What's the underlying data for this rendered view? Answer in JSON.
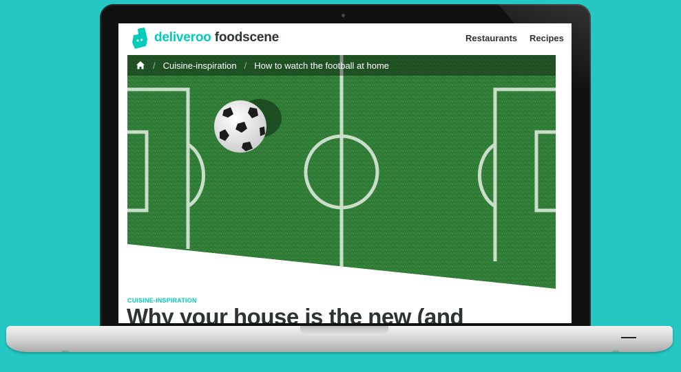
{
  "brand": {
    "name_part1": "deliveroo",
    "name_part2": "foodscene",
    "accent_color": "#00ccbc",
    "logo_icon": "deliveroo-kangaroo-logo"
  },
  "nav": {
    "links": [
      {
        "label": "Restaurants"
      },
      {
        "label": "Recipes"
      }
    ]
  },
  "breadcrumb": {
    "home_icon": "home-icon",
    "items": [
      {
        "label": "Cuisine-inspiration"
      },
      {
        "label": "How to watch the football at home"
      }
    ]
  },
  "article": {
    "category": "CUISINE-INSPIRATION",
    "headline": "Why your house is the new (and"
  },
  "page_background": "#24c7c2"
}
